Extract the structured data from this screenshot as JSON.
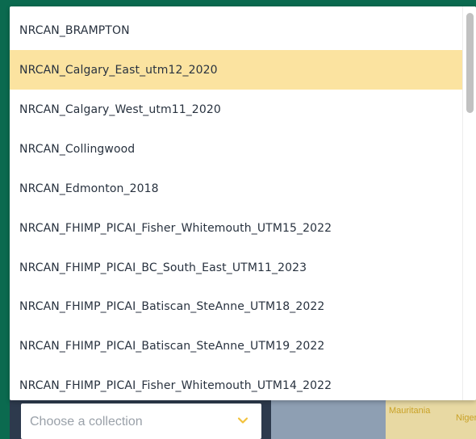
{
  "dropdown": {
    "selected_index": 1,
    "options": [
      "NRCAN_BRAMPTON",
      "NRCAN_Calgary_East_utm12_2020",
      "NRCAN_Calgary_West_utm11_2020",
      "NRCAN_Collingwood",
      "NRCAN_Edmonton_2018",
      "NRCAN_FHIMP_PICAI_Fisher_Whitemouth_UTM15_2022",
      "NRCAN_FHIMP_PICAI_BC_South_East_UTM11_2023",
      "NRCAN_FHIMP_PICAI_Batiscan_SteAnne_UTM18_2022",
      "NRCAN_FHIMP_PICAI_Batiscan_SteAnne_UTM19_2022",
      "NRCAN_FHIMP_PICAI_Fisher_Whitemouth_UTM14_2022"
    ]
  },
  "select": {
    "placeholder": "Choose a collection",
    "chevron_icon": "chevron-down-icon"
  },
  "map": {
    "labels": [
      "Mauritania",
      "Niger"
    ]
  },
  "colors": {
    "frame": "#0b6a4f",
    "selected_option": "#fbe3a0",
    "chevron": "#f2c23b",
    "panel": "#2d3a4d"
  }
}
